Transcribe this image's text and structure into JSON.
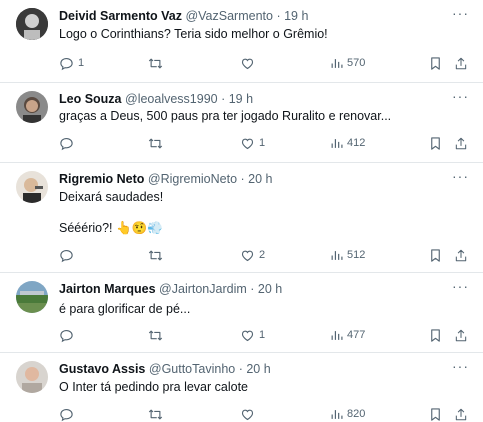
{
  "tweets": [
    {
      "name": "Deivid Sarmento Vaz",
      "handle": "@VazSarmento",
      "time": "· 19 h",
      "lines": [
        "Logo o Corinthians? Teria sido melhor o Grêmio!"
      ],
      "replies": "1",
      "retweets": "",
      "likes": "",
      "views": "570"
    },
    {
      "name": "Leo Souza",
      "handle": "@leoalvess1990",
      "time": "· 19 h",
      "lines": [
        "graças a Deus, 500 paus pra ter jogado Ruralito e renovar..."
      ],
      "replies": "",
      "retweets": "",
      "likes": "1",
      "views": "412"
    },
    {
      "name": "Rigremio Neto",
      "handle": "@RigremioNeto",
      "time": "· 20 h",
      "lines": [
        "Deixará saudades!",
        "Sééério?!"
      ],
      "emojis": [
        "👆",
        "🤨",
        "💨"
      ],
      "replies": "",
      "retweets": "",
      "likes": "2",
      "views": "512"
    },
    {
      "name": "Jairton Marques",
      "handle": "@JairtonJardim",
      "time": "· 20 h",
      "lines": [
        "é para glorificar de pé..."
      ],
      "replies": "",
      "retweets": "",
      "likes": "1",
      "views": "477"
    },
    {
      "name": "Gustavo Assis",
      "handle": "@GuttoTavinho",
      "time": "· 20 h",
      "lines": [
        "O Inter tá pedindo pra levar calote"
      ],
      "replies": "",
      "retweets": "",
      "likes": "",
      "views": "820"
    }
  ],
  "icons": {
    "reply": "reply-icon",
    "retweet": "retweet-icon",
    "like": "like-icon",
    "views": "views-icon",
    "bookmark": "bookmark-icon",
    "share": "share-icon",
    "more": "more-options-icon"
  },
  "colors": {
    "text": "#0f1419",
    "muted": "#536471",
    "divider": "#e3e7ea"
  }
}
